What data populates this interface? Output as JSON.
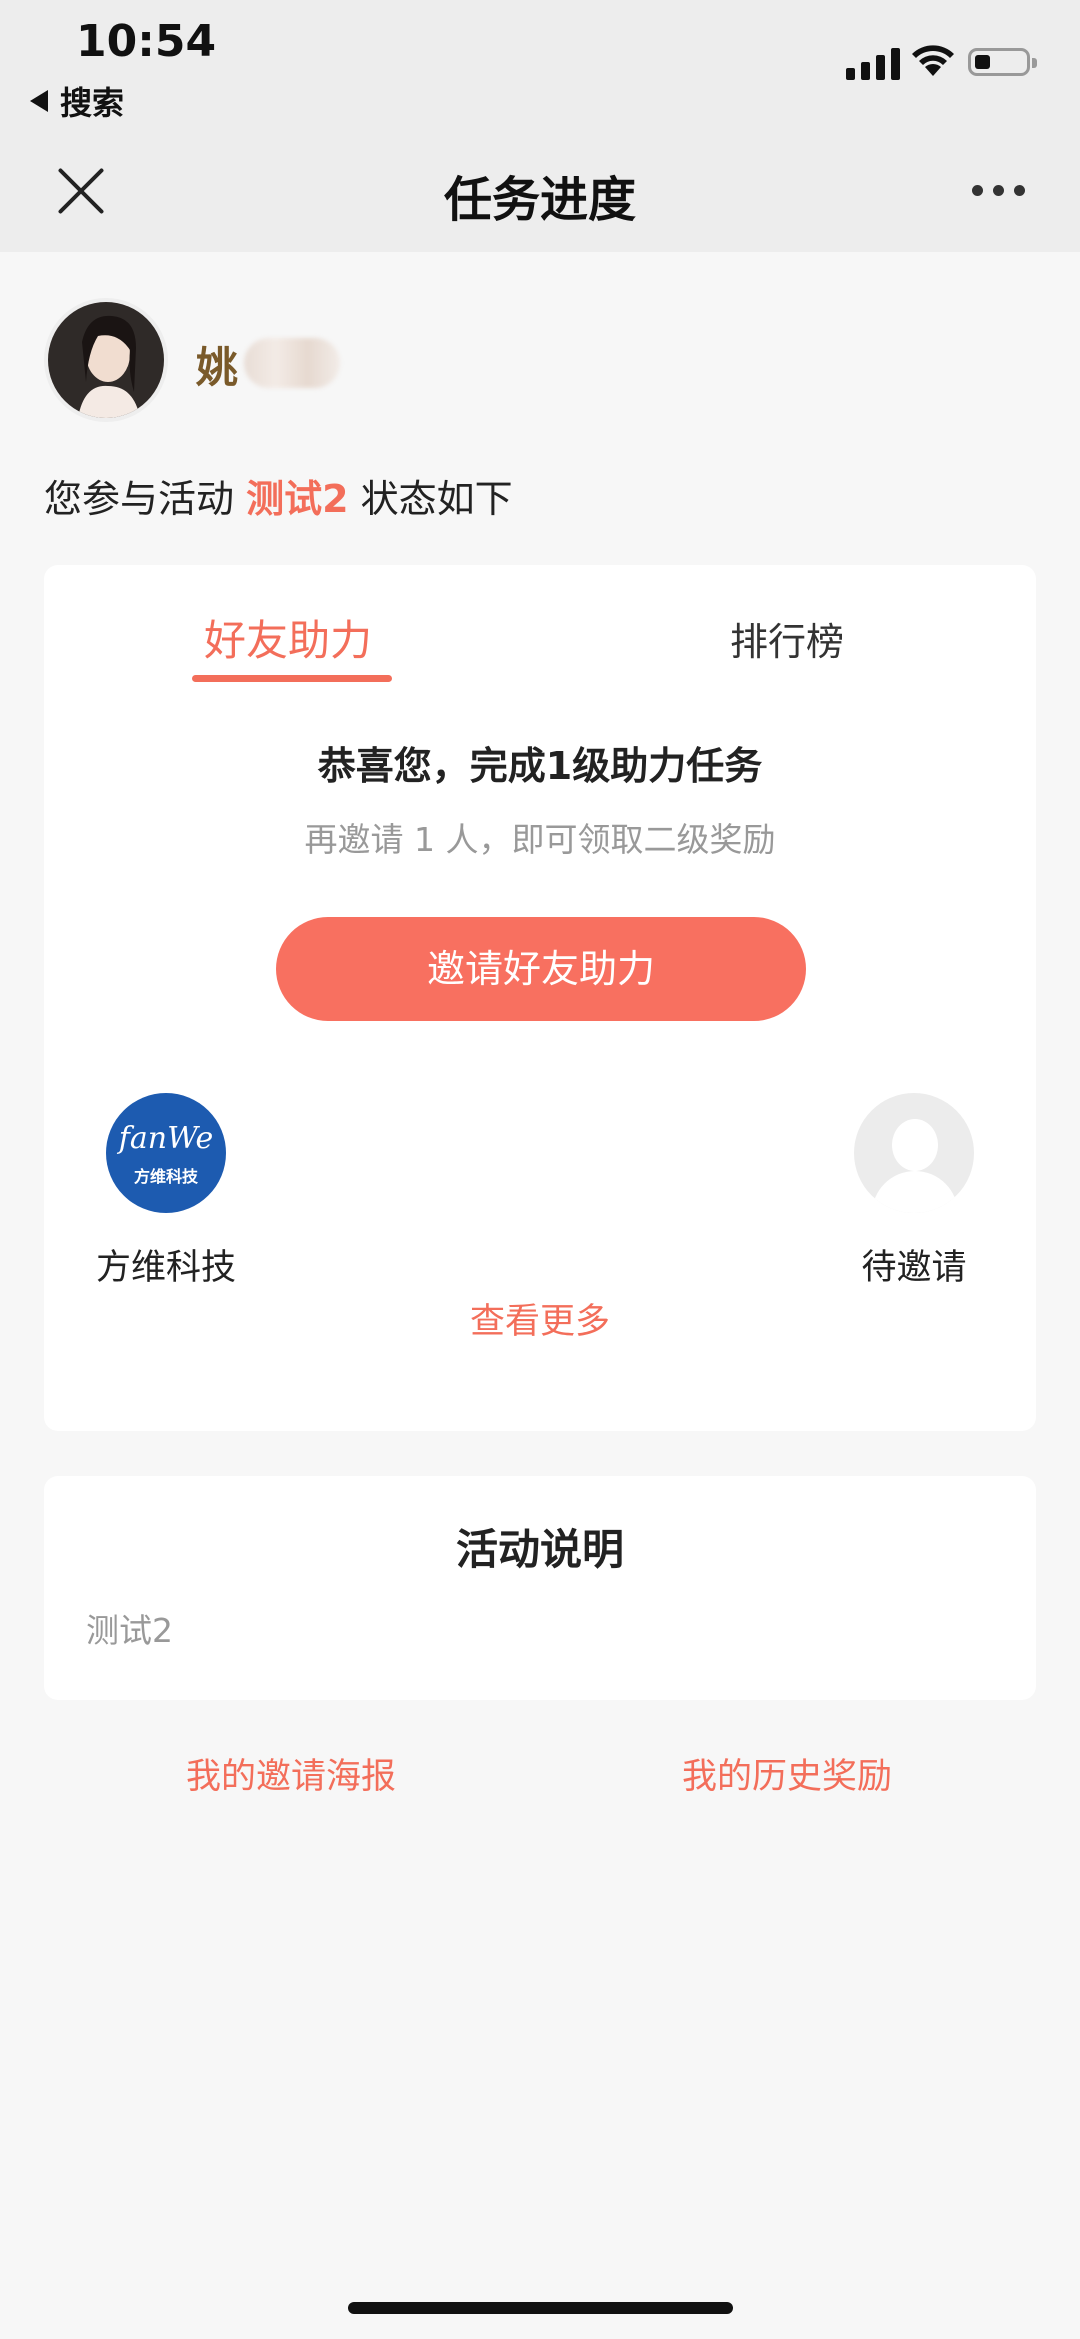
{
  "status_bar": {
    "time": "10:54",
    "back_app": "搜索",
    "icons": [
      "cellular-signal-icon",
      "wifi-icon",
      "battery-icon"
    ]
  },
  "nav": {
    "title": "任务进度",
    "close_icon": "close-icon",
    "more_icon": "more-dots-icon"
  },
  "profile": {
    "name": "姚"
  },
  "intro": {
    "prefix": "您参与活动",
    "activity": "测试2",
    "suffix": "状态如下"
  },
  "task_card": {
    "tabs": [
      {
        "label": "好友助力",
        "active": true
      },
      {
        "label": "排行榜",
        "active": false
      }
    ],
    "congrats": "恭喜您，完成1级助力任务",
    "hint": "再邀请 1 人，即可领取二级奖励",
    "invite_button": "邀请好友助力",
    "friends": [
      {
        "name": "方维科技",
        "logo_text": "fanWe",
        "logo_sub": "方维科技"
      },
      {
        "name": "待邀请"
      }
    ],
    "see_more": "查看更多"
  },
  "description_card": {
    "title": "活动说明",
    "body": "测试2"
  },
  "footer_links": {
    "poster": "我的邀请海报",
    "history": "我的历史奖励"
  },
  "colors": {
    "accent": "#f36e5a",
    "button": "#f87060",
    "background": "#f7f7f7"
  }
}
